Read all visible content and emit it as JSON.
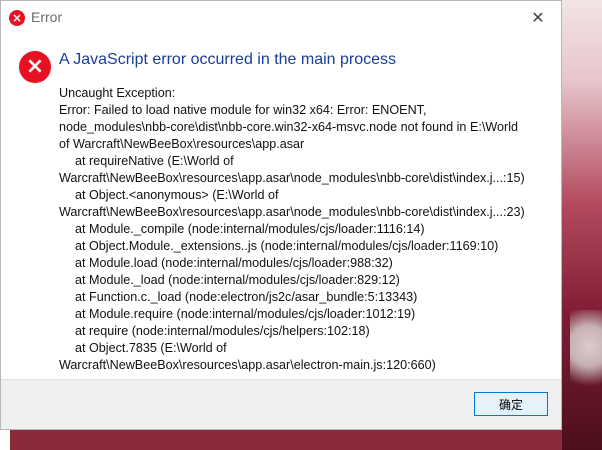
{
  "window": {
    "title": "Error",
    "close_glyph": "✕",
    "error_icon": "error-x-icon",
    "error_icon_glyph": "×"
  },
  "dialog": {
    "heading": "A JavaScript error occurred in the main process",
    "message_lines": [
      {
        "text": "Uncaught Exception:",
        "indent": false
      },
      {
        "text": "Error: Failed to load native module for win32 x64: Error: ENOENT,",
        "indent": false
      },
      {
        "text": "node_modules\\nbb-core\\dist\\nbb-core.win32-x64-msvc.node not found in E:\\World",
        "indent": false
      },
      {
        "text": "of Warcraft\\NewBeeBox\\resources\\app.asar",
        "indent": false
      },
      {
        "text": "at requireNative (E:\\World of",
        "indent": true
      },
      {
        "text": "Warcraft\\NewBeeBox\\resources\\app.asar\\node_modules\\nbb-core\\dist\\index.j...:15)",
        "indent": false
      },
      {
        "text": "at Object.<anonymous> (E:\\World of",
        "indent": true
      },
      {
        "text": "Warcraft\\NewBeeBox\\resources\\app.asar\\node_modules\\nbb-core\\dist\\index.j...:23)",
        "indent": false
      },
      {
        "text": "at Module._compile (node:internal/modules/cjs/loader:1116:14)",
        "indent": true
      },
      {
        "text": "at Object.Module._extensions..js (node:internal/modules/cjs/loader:1169:10)",
        "indent": true
      },
      {
        "text": "at Module.load (node:internal/modules/cjs/loader:988:32)",
        "indent": true
      },
      {
        "text": "at Module._load (node:internal/modules/cjs/loader:829:12)",
        "indent": true
      },
      {
        "text": "at Function.c._load (node:electron/js2c/asar_bundle:5:13343)",
        "indent": true
      },
      {
        "text": "at Module.require (node:internal/modules/cjs/loader:1012:19)",
        "indent": true
      },
      {
        "text": "at require (node:internal/modules/cjs/helpers:102:18)",
        "indent": true
      },
      {
        "text": "at Object.7835 (E:\\World of",
        "indent": true
      },
      {
        "text": "Warcraft\\NewBeeBox\\resources\\app.asar\\electron-main.js:120:660)",
        "indent": false
      }
    ]
  },
  "footer": {
    "ok_label": "确定"
  },
  "colors": {
    "heading": "#1a3d98",
    "error_red": "#e81123",
    "button_border": "#0078d7"
  }
}
